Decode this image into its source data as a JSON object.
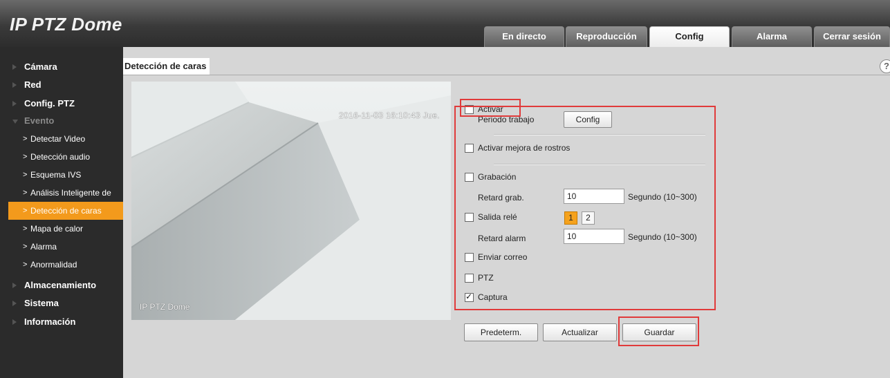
{
  "app": {
    "title": "IP PTZ Dome"
  },
  "tabs": [
    {
      "label": "En directo",
      "active": false
    },
    {
      "label": "Reproducción",
      "active": false
    },
    {
      "label": "Config",
      "active": true
    },
    {
      "label": "Alarma",
      "active": false
    },
    {
      "label": "Cerrar sesión",
      "active": false
    }
  ],
  "sidebar": {
    "items": [
      {
        "label": "Cámara"
      },
      {
        "label": "Red"
      },
      {
        "label": "Config. PTZ"
      },
      {
        "label": "Evento"
      }
    ],
    "sub_items": [
      {
        "label": "Detectar Video"
      },
      {
        "label": "Detección audio"
      },
      {
        "label": "Esquema IVS"
      },
      {
        "label": "Análisis Inteligente de"
      },
      {
        "label": "Detección de caras"
      },
      {
        "label": "Mapa de calor"
      },
      {
        "label": "Alarma"
      },
      {
        "label": "Anormalidad"
      }
    ],
    "items_after": [
      {
        "label": "Almacenamiento"
      },
      {
        "label": "Sistema"
      },
      {
        "label": "Información"
      }
    ],
    "active_color": "#f39a1c"
  },
  "panel": {
    "title": "Detección de caras",
    "help_icon": "?",
    "video": {
      "timestamp": "2016-11-03 16:10:43 Jue.",
      "channel_name": "IP PTZ Dome"
    }
  },
  "form": {
    "enable_label": "Activar",
    "work_period_label": "Periodo trabajo",
    "work_period_button": "Config",
    "face_enhance_label": "Activar mejora de rostros",
    "record_label": "Grabación",
    "record_delay_label": "Retard grab.",
    "record_delay_value": "10",
    "record_delay_unit": "Segundo (10~300)",
    "relay_label": "Salida relé",
    "relay_options": [
      "1",
      "2"
    ],
    "alarm_delay_label": "Retard alarm",
    "alarm_delay_value": "10",
    "alarm_delay_unit": "Segundo (10~300)",
    "email_label": "Enviar correo",
    "ptz_label": "PTZ",
    "snapshot_label": "Captura"
  },
  "actions": {
    "default_label": "Predeterm.",
    "refresh_label": "Actualizar",
    "save_label": "Guardar"
  },
  "colors": {
    "highlight_red": "#e03a3a",
    "relay_active": "#f5a21d"
  }
}
